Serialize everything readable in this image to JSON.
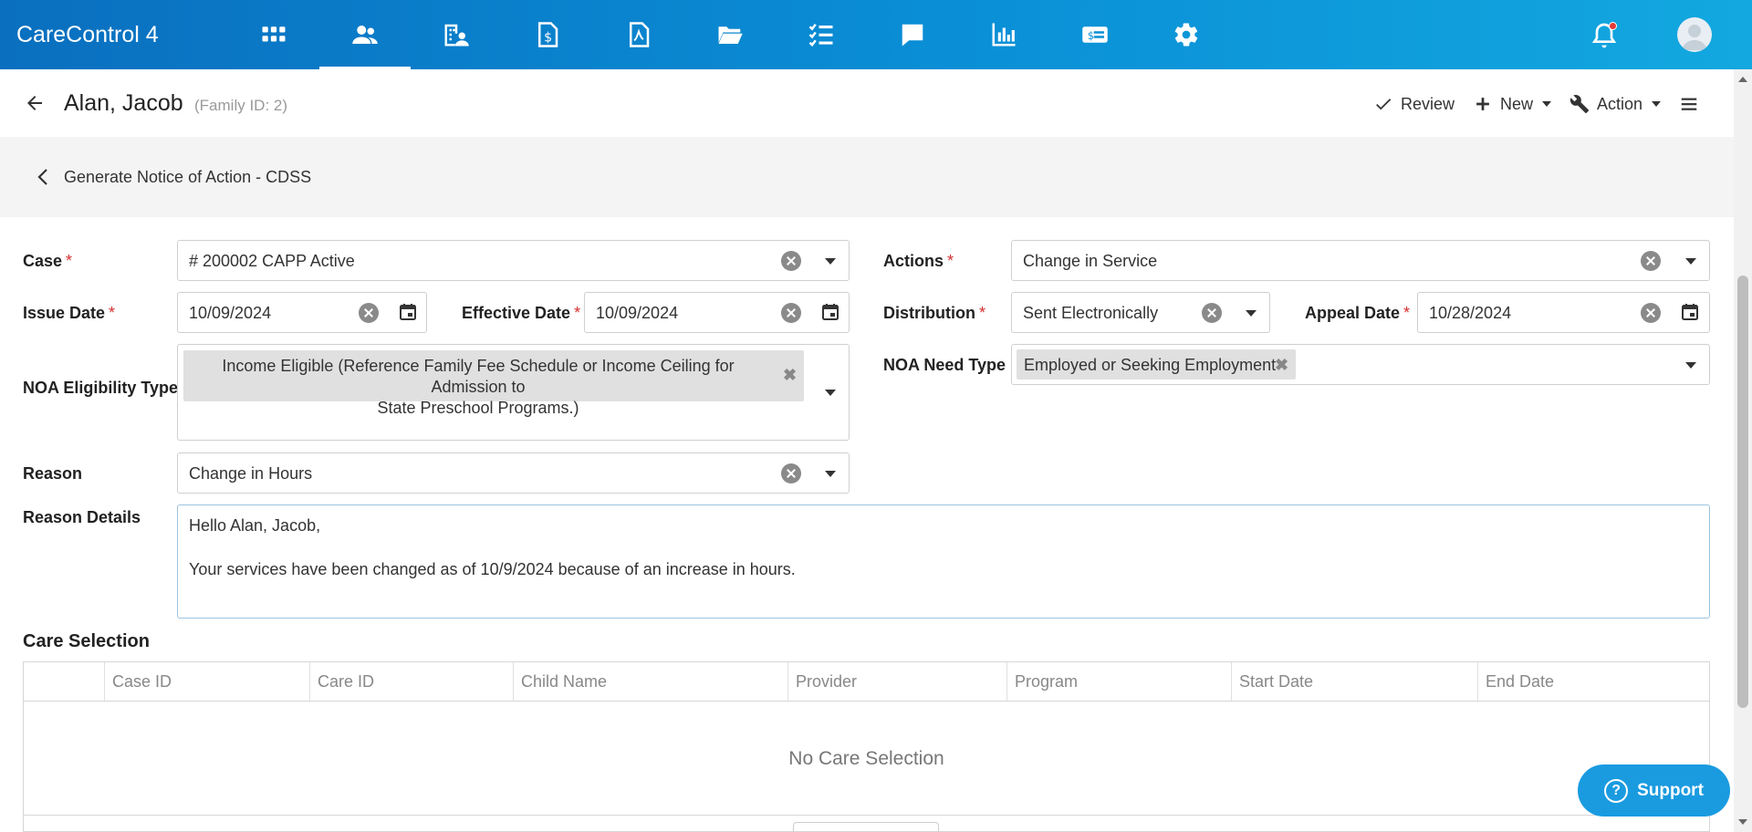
{
  "app": {
    "title": "CareControl 4"
  },
  "nav": {
    "icons": [
      "apps-grid-icon",
      "people-icon",
      "building-icon",
      "invoice-icon",
      "document-icon",
      "folder-icon",
      "checklist-icon",
      "chat-icon",
      "bar-chart-icon",
      "payment-card-icon",
      "gear-icon"
    ],
    "active": "people-icon"
  },
  "header": {
    "name": "Alan, Jacob",
    "family_id": "(Family ID: 2)",
    "review": "Review",
    "new": "New",
    "action": "Action"
  },
  "breadcrumb": {
    "title": "Generate Notice of Action - CDSS"
  },
  "form": {
    "case": {
      "label": "Case",
      "value": "# 200002 CAPP  Active"
    },
    "actions": {
      "label": "Actions",
      "value": "Change in Service"
    },
    "issue_date": {
      "label": "Issue Date",
      "value": "10/09/2024"
    },
    "effective_date": {
      "label": "Effective Date",
      "value": "10/09/2024"
    },
    "distribution": {
      "label": "Distribution",
      "value": "Sent Electronically"
    },
    "appeal_date": {
      "label": "Appeal Date",
      "value": "10/28/2024"
    },
    "eligibility": {
      "label": "NOA Eligibility Type",
      "chip_line1": "Income Eligible (Reference Family Fee Schedule or Income Ceiling for Admission to",
      "chip_line2": "State Preschool Programs.)"
    },
    "need": {
      "label": "NOA Need Type",
      "chip": "Employed or Seeking Employment"
    },
    "reason": {
      "label": "Reason",
      "value": "Change in Hours"
    },
    "reason_details": {
      "label": "Reason Details",
      "line1": "Hello Alan, Jacob,",
      "line2": "Your services have been changed as of 10/9/2024 because of an increase in hours."
    },
    "required_mark": "*",
    "chip_remove": "✖"
  },
  "care_selection": {
    "title": "Care Selection",
    "columns": [
      "Case ID",
      "Care ID",
      "Child Name",
      "Provider",
      "Program",
      "Start Date",
      "End Date"
    ],
    "empty": "No Care Selection"
  },
  "support": {
    "label": "Support",
    "glyph": "?"
  },
  "colors": {
    "nav_start": "#0a6fbf",
    "nav_end": "#13a8e0",
    "required": "#d32f2f",
    "support": "#1a9be0"
  }
}
